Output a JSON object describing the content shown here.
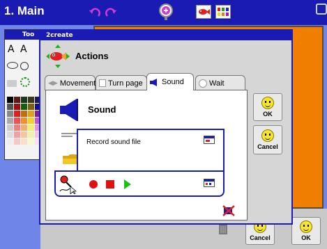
{
  "top_bar": {
    "title": "1. Main"
  },
  "tools_panel": {
    "title": "Too"
  },
  "dialog": {
    "title": "2create",
    "heading": "Actions",
    "tabs": [
      {
        "label": "Movement",
        "active": false
      },
      {
        "label": "Turn page",
        "active": false
      },
      {
        "label": "Sound",
        "active": true
      },
      {
        "label": "Wait",
        "active": false
      }
    ],
    "sound_heading": "Sound",
    "record_label": "Record sound file",
    "ok_label": "OK",
    "cancel_label": "Cancel"
  },
  "bottom_buttons": {
    "cancel_label": "Cancel",
    "ok_label": "OK"
  },
  "colors": {
    "title_bar": "#1a1bb2",
    "desktop": "#6f86e8",
    "page": "#f07e00",
    "record": "#e01010",
    "play": "#18c018"
  },
  "icons": [
    "undo-icon",
    "redo-icon",
    "zoom-icon",
    "fish-icon",
    "palette-icon",
    "close-icon",
    "speaker-icon",
    "folder-icon",
    "microphone-icon",
    "trash-icon"
  ]
}
